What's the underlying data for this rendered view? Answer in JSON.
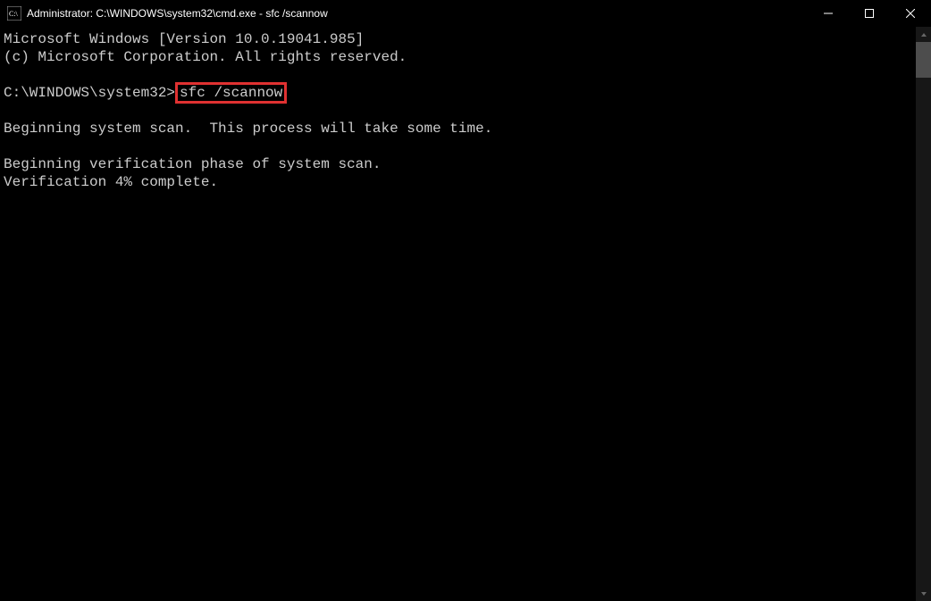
{
  "titlebar": {
    "title": "Administrator: C:\\WINDOWS\\system32\\cmd.exe - sfc  /scannow"
  },
  "output": {
    "line1": "Microsoft Windows [Version 10.0.19041.985]",
    "line2": "(c) Microsoft Corporation. All rights reserved.",
    "blank1": "",
    "prompt": "C:\\WINDOWS\\system32>",
    "command": "sfc /scannow",
    "blank2": "",
    "line3": "Beginning system scan.  This process will take some time.",
    "blank3": "",
    "line4": "Beginning verification phase of system scan.",
    "line5": "Verification 4% complete."
  }
}
